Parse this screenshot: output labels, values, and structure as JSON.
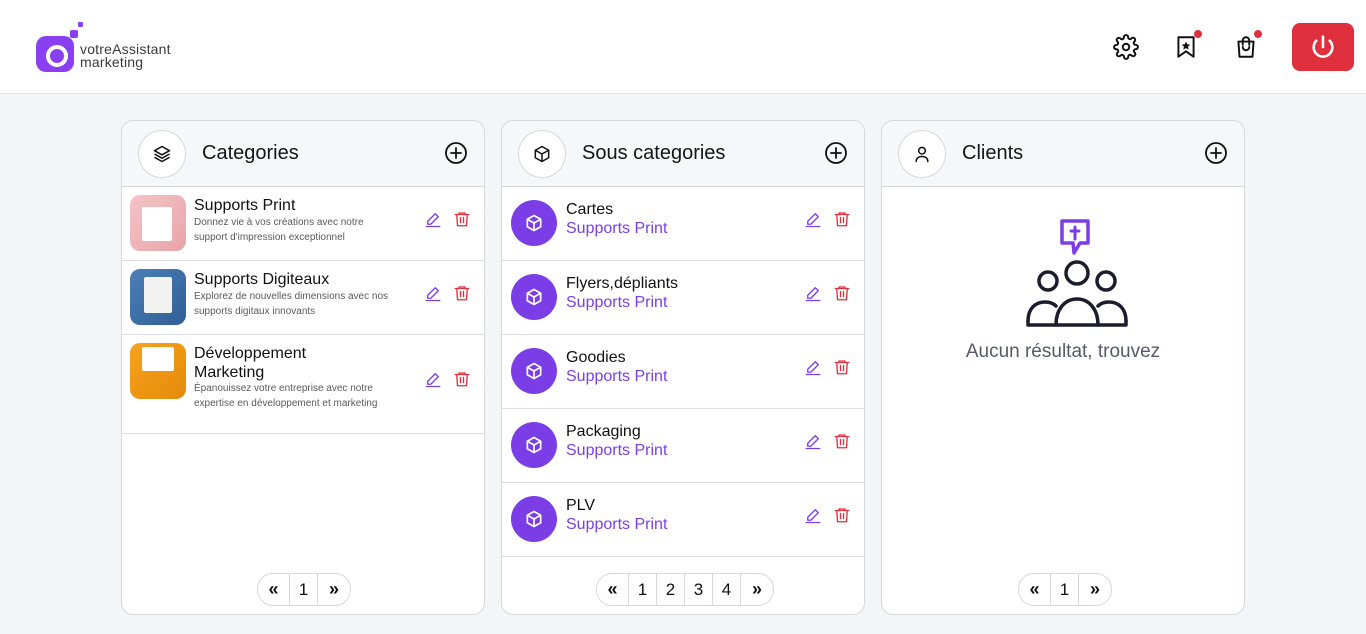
{
  "brand": {
    "line1": "votreAssistant",
    "line2": "marketing",
    "color": "#8a3ff0"
  },
  "header": {
    "icons": [
      "gear-icon",
      "bookmark-star-icon",
      "shopping-bag-icon",
      "power-icon"
    ],
    "accent_red": "#e0303d"
  },
  "panels": {
    "categories": {
      "title": "Categories",
      "icon": "layers-icon",
      "items": [
        {
          "title": "Supports Print",
          "desc": "Donnez vie à vos créations avec notre support d'impression exceptionnel"
        },
        {
          "title": "Supports Digiteaux",
          "desc": "Explorez de nouvelles dimensions avec nos supports digitaux innovants"
        },
        {
          "title": "Développement Marketing",
          "desc": "Épanouissez votre entreprise avec notre expertise en développement et marketing"
        }
      ],
      "pager": {
        "prev": "«",
        "pages": [
          "1"
        ],
        "next": "»"
      }
    },
    "subcategories": {
      "title": "Sous categories",
      "icon": "cube-icon",
      "items": [
        {
          "title": "Cartes",
          "parent": "Supports Print"
        },
        {
          "title": "Flyers,dépliants",
          "parent": "Supports Print"
        },
        {
          "title": "Goodies",
          "parent": "Supports Print"
        },
        {
          "title": "Packaging",
          "parent": "Supports Print"
        },
        {
          "title": "PLV",
          "parent": "Supports Print"
        }
      ],
      "pager": {
        "prev": "«",
        "pages": [
          "1",
          "2",
          "3",
          "4"
        ],
        "next": "»"
      }
    },
    "clients": {
      "title": "Clients",
      "icon": "user-icon",
      "empty_text": "Aucun résultat, trouvez",
      "pager": {
        "prev": "«",
        "pages": [
          "1"
        ],
        "next": "»"
      }
    }
  },
  "colors": {
    "purple": "#7b3ee6",
    "delete_red": "#e0303d"
  }
}
